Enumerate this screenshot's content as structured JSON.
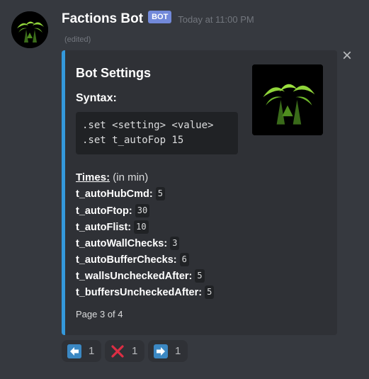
{
  "message": {
    "username": "Factions Bot",
    "bot_tag": "BOT",
    "timestamp": "Today at 11:00 PM",
    "edited": "(edited)"
  },
  "embed": {
    "title": "Bot Settings",
    "syntax_label": "Syntax:",
    "code_lines": [
      ".set <setting> <value>",
      ".set t_autoFop 15"
    ],
    "times_label": "Times:",
    "times_note": " (in min)",
    "settings": [
      {
        "key": "t_autoHubCmd:",
        "value": "5"
      },
      {
        "key": "t_autoFtop:",
        "value": "30"
      },
      {
        "key": "t_autoFlist:",
        "value": "10"
      },
      {
        "key": "t_autoWallChecks:",
        "value": "3"
      },
      {
        "key": "t_autoBufferChecks:",
        "value": "6"
      },
      {
        "key": "t_wallsUncheckedAfter:",
        "value": "5"
      },
      {
        "key": "t_buffersUncheckedAfter:",
        "value": "5"
      }
    ],
    "footer": "Page 3 of 4",
    "accent_color": "#3498db"
  },
  "reactions": [
    {
      "icon": "arrow-left-icon",
      "count": "1"
    },
    {
      "icon": "cross-mark-icon",
      "count": "1"
    },
    {
      "icon": "arrow-right-icon",
      "count": "1"
    }
  ],
  "colors": {
    "background": "#36393f",
    "embed_bg": "#2f3136",
    "bot_tag": "#7289da"
  }
}
